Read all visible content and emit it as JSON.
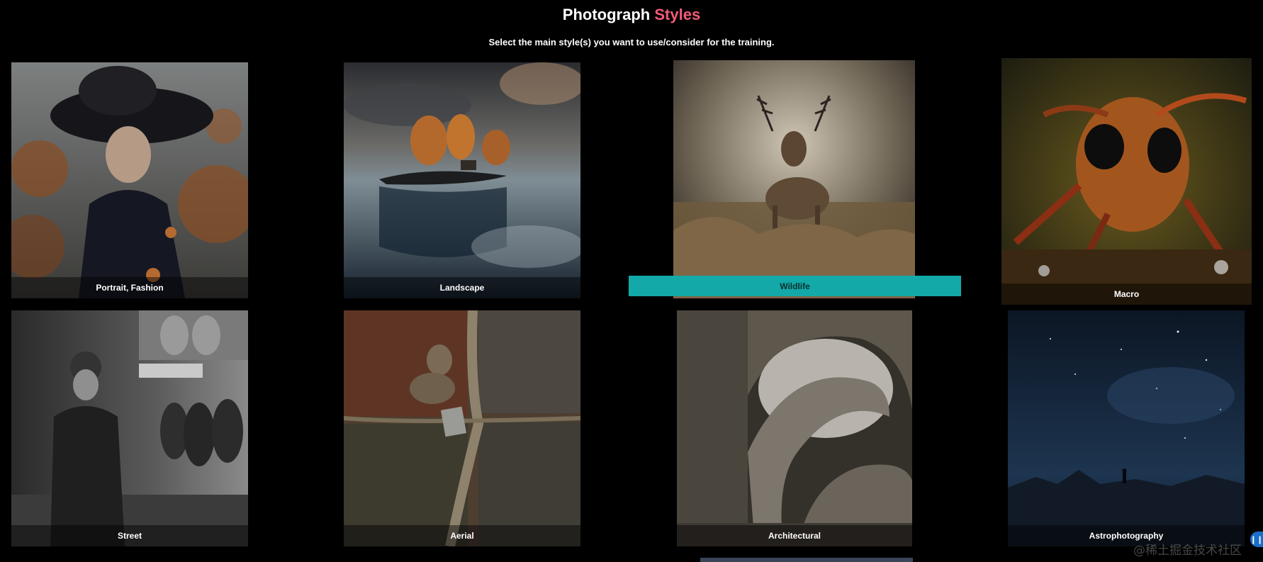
{
  "header": {
    "title_main": "Photograph",
    "title_accent": "Styles",
    "subtitle": "Select the main style(s) you want to use/consider for the training."
  },
  "styles": [
    {
      "label": "Portrait, Fashion",
      "selected": false
    },
    {
      "label": "Landscape",
      "selected": false
    },
    {
      "label": "Wildlife",
      "selected": true
    },
    {
      "label": "Macro",
      "selected": false
    },
    {
      "label": "Street",
      "selected": false
    },
    {
      "label": "Aerial",
      "selected": false
    },
    {
      "label": "Architectural",
      "selected": false
    },
    {
      "label": "Astrophotography",
      "selected": false
    }
  ],
  "watermark": "@稀土掘金技术社区",
  "colors": {
    "accent": "#f25a78",
    "selected_bar": "#12a9a8",
    "background": "#000000"
  }
}
